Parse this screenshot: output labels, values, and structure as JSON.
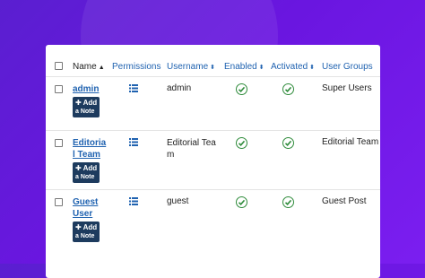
{
  "header": {
    "name": "Name",
    "permissions": "Permissions",
    "username": "Username",
    "enabled": "Enabled",
    "activated": "Activated",
    "user_groups": "User Groups",
    "name_sort": "▲",
    "username_sort": "⬍",
    "enabled_sort": "⬍",
    "activated_sort": "⬍"
  },
  "users": [
    {
      "name_line1": "admin",
      "name_line2": "",
      "username": "admin",
      "username_line2": "",
      "group": "Super Users",
      "note_plus": "✚ Add",
      "note_text": "a Note"
    },
    {
      "name_line1": "Editoria",
      "name_line2": "l Team",
      "username": "Editorial Tea",
      "username_line2": "m",
      "group": "Editorial Team",
      "note_plus": "✚ Add",
      "note_text": "a Note"
    },
    {
      "name_line1": "Guest",
      "name_line2": "User",
      "username": "guest",
      "username_line2": "",
      "group": "Guest Post",
      "note_plus": "✚ Add",
      "note_text": "a Note"
    }
  ],
  "colors": {
    "link": "#1f62b0",
    "check": "#2e8b3a",
    "button": "#1d3b5e"
  },
  "icons": {
    "permissions": "list-icon",
    "enabled": "check-circle-icon",
    "activated": "check-circle-icon"
  }
}
